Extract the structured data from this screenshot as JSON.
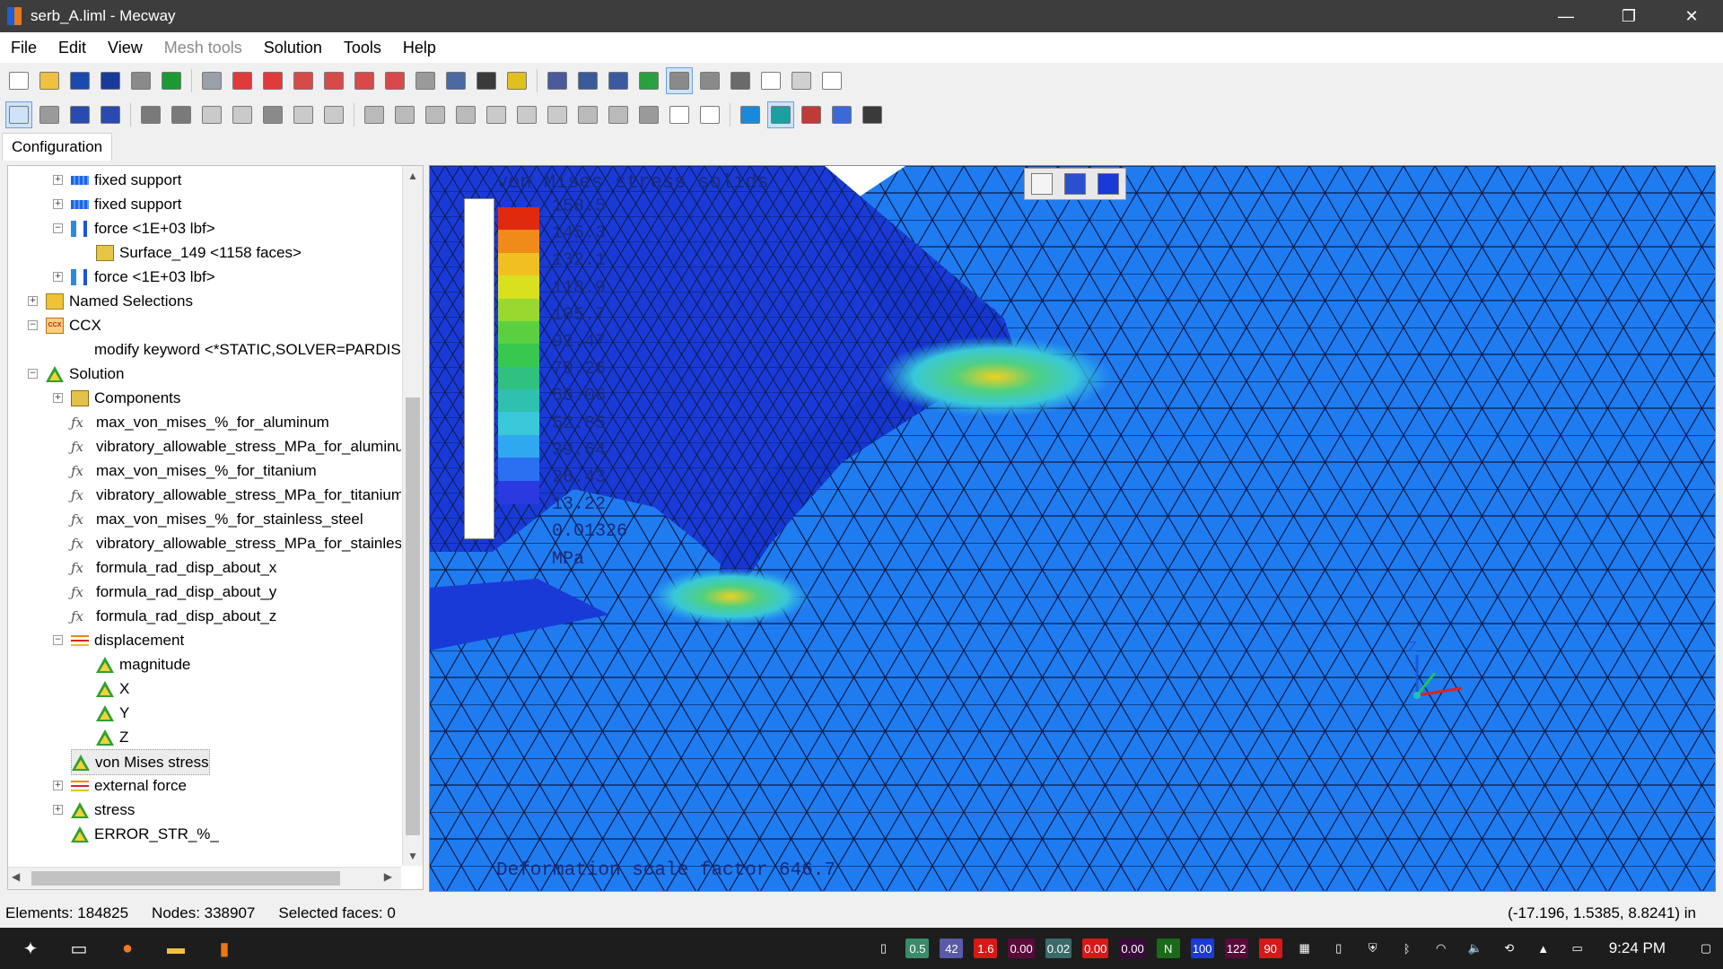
{
  "window": {
    "title": "serb_A.liml - Mecway",
    "minimize": "—",
    "maximize": "❐",
    "close": "✕"
  },
  "menu": [
    {
      "label": "File",
      "disabled": false
    },
    {
      "label": "Edit",
      "disabled": false
    },
    {
      "label": "View",
      "disabled": false
    },
    {
      "label": "Mesh tools",
      "disabled": true
    },
    {
      "label": "Solution",
      "disabled": false
    },
    {
      "label": "Tools",
      "disabled": false
    },
    {
      "label": "Help",
      "disabled": false
    }
  ],
  "tabs": {
    "configuration": "Configuration"
  },
  "tree": [
    {
      "label": "fixed support",
      "icon": "support-icon",
      "level": 2,
      "exp": "+"
    },
    {
      "label": "fixed support",
      "icon": "support-icon",
      "level": 2,
      "exp": "+"
    },
    {
      "label": "force <1E+03 lbf>",
      "icon": "force-icon",
      "level": 2,
      "exp": "-"
    },
    {
      "label": "Surface_149 <1158 faces>",
      "icon": "surface-icon",
      "level": 3,
      "exp": ""
    },
    {
      "label": "force <1E+03 lbf>",
      "icon": "force-icon",
      "level": 2,
      "exp": "+"
    },
    {
      "label": "Named Selections",
      "icon": "folder-icon",
      "level": 1,
      "exp": "+"
    },
    {
      "label": "CCX",
      "icon": "ccx-icon",
      "level": 1,
      "exp": "-"
    },
    {
      "label": "modify keyword <*STATIC,SOLVER=PARDISO>",
      "icon": "",
      "level": 2,
      "exp": ""
    },
    {
      "label": "Solution",
      "icon": "solution-icon",
      "level": 1,
      "exp": "-"
    },
    {
      "label": "Components",
      "icon": "components-icon",
      "level": 2,
      "exp": "+"
    },
    {
      "label": "max_von_mises_%_for_aluminum",
      "icon": "formula-icon",
      "level": 2,
      "exp": ""
    },
    {
      "label": "vibratory_allowable_stress_MPa_for_aluminum",
      "icon": "formula-icon",
      "level": 2,
      "exp": ""
    },
    {
      "label": "max_von_mises_%_for_titanium",
      "icon": "formula-icon",
      "level": 2,
      "exp": ""
    },
    {
      "label": "vibratory_allowable_stress_MPa_for_titanium",
      "icon": "formula-icon",
      "level": 2,
      "exp": ""
    },
    {
      "label": "max_von_mises_%_for_stainless_steel",
      "icon": "formula-icon",
      "level": 2,
      "exp": ""
    },
    {
      "label": "vibratory_allowable_stress_MPa_for_stainless_steel",
      "icon": "formula-icon",
      "level": 2,
      "exp": ""
    },
    {
      "label": "formula_rad_disp_about_x",
      "icon": "formula-icon",
      "level": 2,
      "exp": ""
    },
    {
      "label": "formula_rad_disp_about_y",
      "icon": "formula-icon",
      "level": 2,
      "exp": ""
    },
    {
      "label": "formula_rad_disp_about_z",
      "icon": "formula-icon",
      "level": 2,
      "exp": ""
    },
    {
      "label": "displacement",
      "icon": "vector-icon",
      "level": 2,
      "exp": "-"
    },
    {
      "label": "magnitude",
      "icon": "solution-icon",
      "level": 3,
      "exp": ""
    },
    {
      "label": "X",
      "icon": "solution-icon",
      "level": 3,
      "exp": ""
    },
    {
      "label": "Y",
      "icon": "solution-icon",
      "level": 3,
      "exp": ""
    },
    {
      "label": "Z",
      "icon": "solution-icon",
      "level": 3,
      "exp": ""
    },
    {
      "label": "von Mises stress",
      "icon": "solution-icon",
      "level": 2,
      "exp": "",
      "selected": true
    },
    {
      "label": "external force",
      "icon": "vector-icon",
      "level": 2,
      "exp": "+"
    },
    {
      "label": "stress",
      "icon": "solution-icon",
      "level": 2,
      "exp": "+"
    },
    {
      "label": "ERROR_STR_%_",
      "icon": "solution-icon",
      "level": 2,
      "exp": ""
    }
  ],
  "viewport": {
    "legend_title": "von Mises stress solids",
    "legend_values": [
      "158.5",
      "145.3",
      "132.1",
      "118.9",
      "105.7",
      "92.47",
      "79.26",
      "66.06",
      "52.85",
      "39.64",
      "26.43",
      "13.22",
      "0.01326"
    ],
    "legend_unit": "MPa",
    "legend_colors": [
      "#e02a10",
      "#f08a18",
      "#f0c020",
      "#d8e020",
      "#9ad830",
      "#5ad040",
      "#38c850",
      "#30c080",
      "#30c0b0",
      "#38c8d8",
      "#30a8f0",
      "#2a70f0",
      "#2a3ae0"
    ],
    "deformation": "Deformation scale factor 646.7",
    "axis_label": "Z"
  },
  "status": {
    "elements": "Elements: 184825",
    "nodes": "Nodes: 338907",
    "faces": "Selected faces: 0",
    "coords": "(-17.196, 1.5385, 8.8241) in"
  },
  "taskbar": {
    "tray": [
      {
        "text": "0.5",
        "color": "#3b8a6a"
      },
      {
        "text": "42",
        "color": "#5a5aa8"
      },
      {
        "text": "1.6",
        "color": "#d81818"
      },
      {
        "text": "0.00",
        "color": "#5a0a3a"
      },
      {
        "text": "0.02",
        "color": "#3a6a6a"
      },
      {
        "text": "0.00",
        "color": "#d81818"
      },
      {
        "text": "0.00",
        "color": "#3a0a3a"
      },
      {
        "text": "N",
        "color": "#1a6a1a"
      },
      {
        "text": "100",
        "color": "#1a3ad8"
      },
      {
        "text": "122",
        "color": "#5a0a3a"
      },
      {
        "text": "90",
        "color": "#d81818"
      }
    ],
    "clock": "9:24 PM"
  }
}
